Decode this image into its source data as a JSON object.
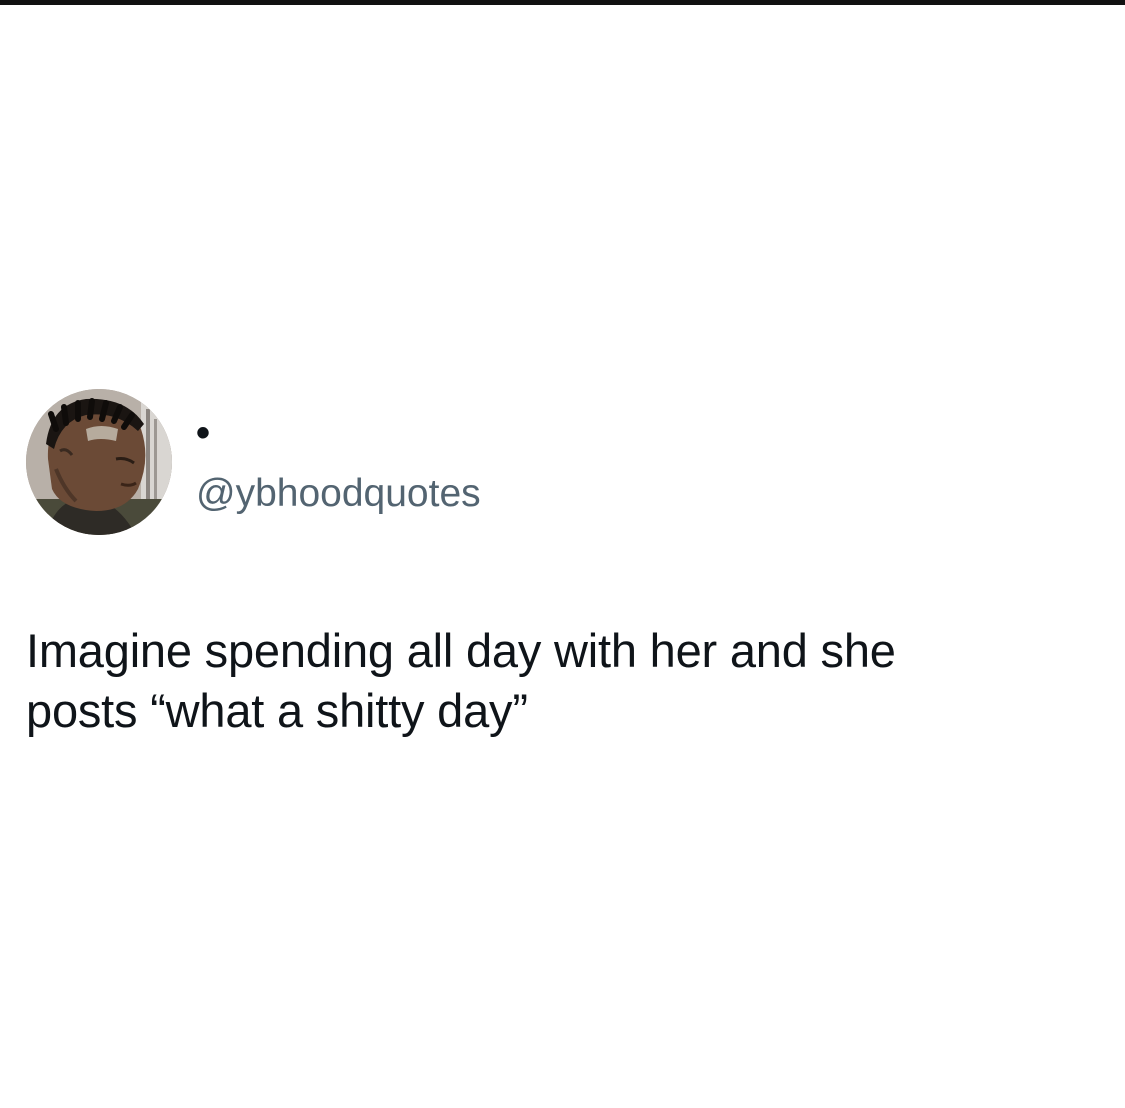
{
  "tweet": {
    "display_name": "•",
    "handle": "@ybhoodquotes",
    "text_lines": [
      "Imagine spending all day with her and she",
      "posts “what a shitty day”"
    ]
  }
}
